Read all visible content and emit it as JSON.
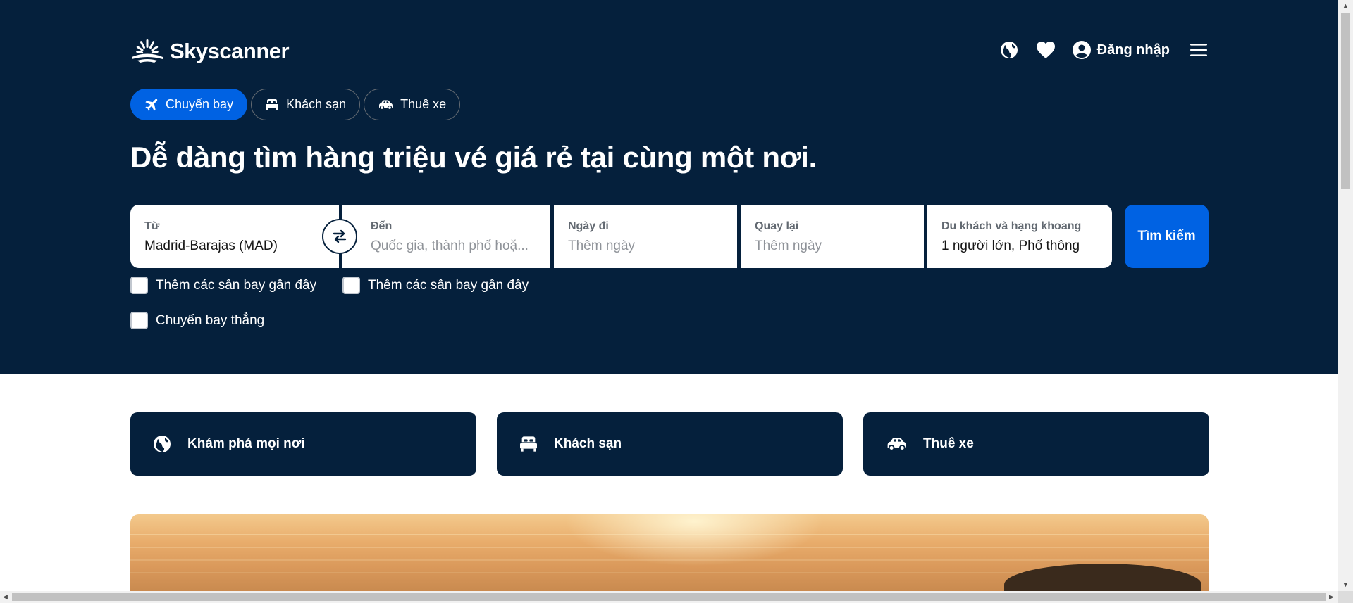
{
  "header": {
    "logo_text": "Skyscanner",
    "login_label": "Đăng nhập",
    "icons": [
      "globe-icon",
      "heart-icon",
      "user-icon",
      "menu-icon"
    ]
  },
  "tabs": [
    {
      "label": "Chuyến bay",
      "icon": "plane-icon",
      "active": true
    },
    {
      "label": "Khách sạn",
      "icon": "bed-icon",
      "active": false
    },
    {
      "label": "Thuê xe",
      "icon": "car-icon",
      "active": false
    }
  ],
  "headline": "Dễ dàng tìm hàng triệu vé giá rẻ tại cùng một nơi.",
  "search": {
    "from": {
      "label": "Từ",
      "value": "Madrid-Barajas (MAD)"
    },
    "to": {
      "label": "Đến",
      "placeholder": "Quốc gia, thành phố hoặ..."
    },
    "depart": {
      "label": "Ngày đi",
      "placeholder": "Thêm ngày"
    },
    "return": {
      "label": "Quay lại",
      "placeholder": "Thêm ngày"
    },
    "travellers": {
      "label": "Du khách và hạng khoang",
      "value": "1 người lớn, Phổ thông"
    },
    "button_label": "Tìm kiếm"
  },
  "options": {
    "nearby_from": "Thêm các sân bay gần đây",
    "nearby_to": "Thêm các sân bay gần đây",
    "direct": "Chuyến bay thẳng"
  },
  "quick_links": [
    {
      "label": "Khám phá mọi nơi",
      "icon": "globe-icon"
    },
    {
      "label": "Khách sạn",
      "icon": "bed-icon"
    },
    {
      "label": "Thuê xe",
      "icon": "car-icon"
    }
  ],
  "colors": {
    "hero_bg": "#05203c",
    "accent": "#0062e3",
    "text_white": "#ffffff"
  }
}
